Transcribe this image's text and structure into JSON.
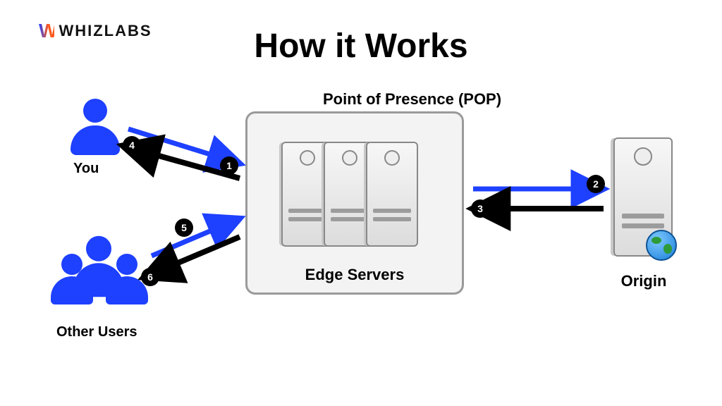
{
  "brand": {
    "name": "WHIZLABS"
  },
  "title": "How it Works",
  "pop": {
    "heading": "Point of Presence (POP)",
    "caption": "Edge Servers"
  },
  "origin": {
    "label": "Origin"
  },
  "users": {
    "you": "You",
    "others": "Other Users"
  },
  "steps": {
    "s1": "1",
    "s2": "2",
    "s3": "3",
    "s4": "4",
    "s5": "5",
    "s6": "6"
  },
  "flow": [
    {
      "n": 1,
      "from": "You",
      "to": "Edge Servers",
      "dir": "request"
    },
    {
      "n": 2,
      "from": "Edge Servers",
      "to": "Origin",
      "dir": "request"
    },
    {
      "n": 3,
      "from": "Origin",
      "to": "Edge Servers",
      "dir": "response"
    },
    {
      "n": 4,
      "from": "Edge Servers",
      "to": "You",
      "dir": "response"
    },
    {
      "n": 5,
      "from": "Other Users",
      "to": "Edge Servers",
      "dir": "request"
    },
    {
      "n": 6,
      "from": "Edge Servers",
      "to": "Other Users",
      "dir": "response"
    }
  ],
  "colors": {
    "blue": "#1e40ff",
    "black": "#000000"
  }
}
